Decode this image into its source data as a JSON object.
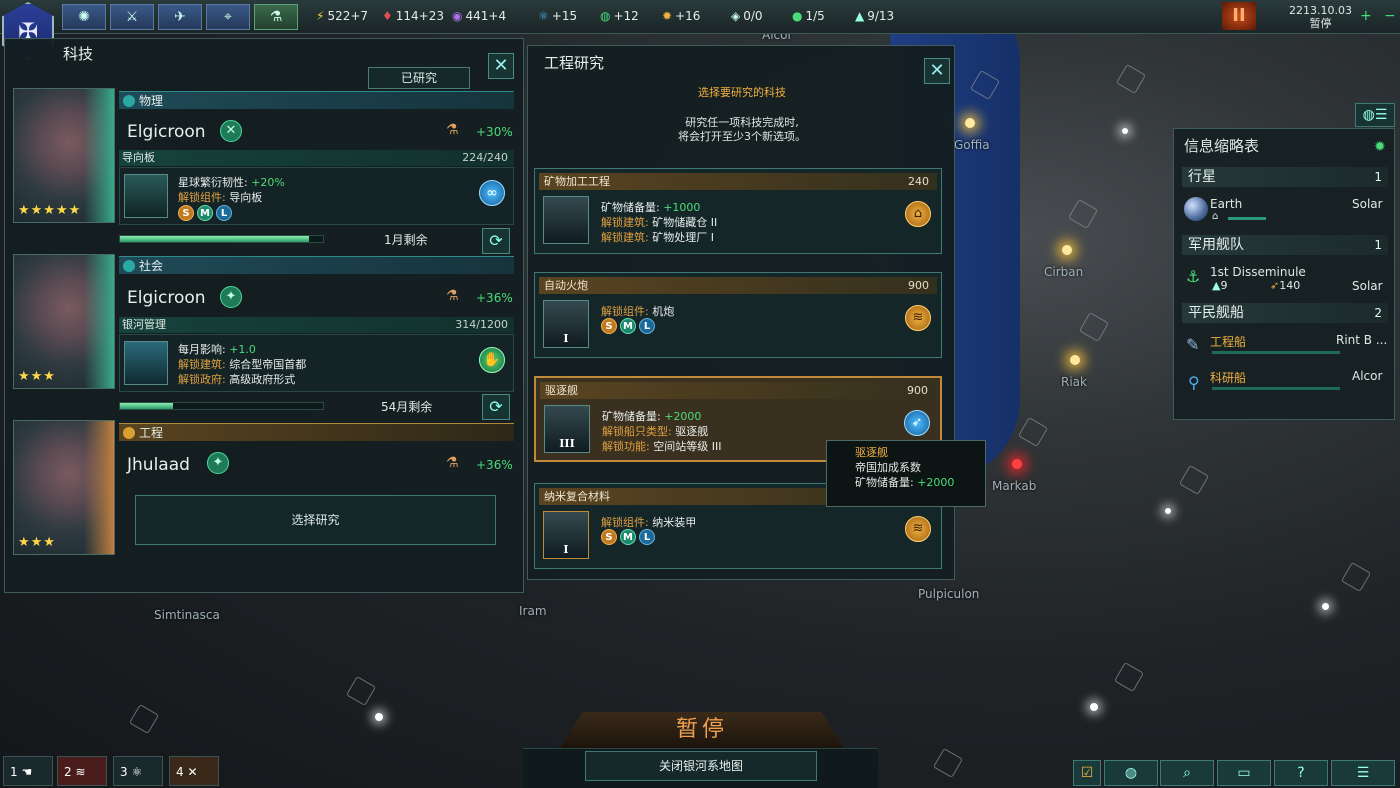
{
  "topbar": {
    "tabs": [
      {
        "icon": "galaxy-icon"
      },
      {
        "icon": "fleet-icon"
      },
      {
        "icon": "ships-icon"
      },
      {
        "icon": "map-icon"
      },
      {
        "icon": "tech-icon"
      }
    ],
    "resources": [
      {
        "icon": "energy-icon",
        "glyph": "⚡",
        "value": "522+7"
      },
      {
        "icon": "minerals-icon",
        "glyph": "♦",
        "value": "114+23"
      },
      {
        "icon": "influence-icon",
        "glyph": "◉",
        "value": "441+4"
      },
      {
        "icon": "physics-icon",
        "glyph": "⚛",
        "value": "+15"
      },
      {
        "icon": "society-icon",
        "glyph": "◍",
        "value": "+12"
      },
      {
        "icon": "engineering-icon",
        "glyph": "✹",
        "value": "+16"
      },
      {
        "icon": "edicts-icon",
        "glyph": "◈",
        "value": "0/0"
      },
      {
        "icon": "planets-icon",
        "glyph": "●",
        "value": "1/5"
      },
      {
        "icon": "fleet-cap-icon",
        "glyph": "▲",
        "value": "9/13"
      }
    ],
    "date": "2213.10.03",
    "status": "暂停"
  },
  "tech_panel": {
    "title": "科技",
    "researched_button": "已研究",
    "categories": [
      {
        "name": "物理",
        "scientist": "Elgicroon",
        "stars": "★★★★★",
        "bonus": "+30%",
        "project": "导向板",
        "progress_text": "224/240",
        "progress": 0.93,
        "effect_label": "星球繁衍韧性: ",
        "effect_value": "+20%",
        "unlock_label": "解锁组件: ",
        "unlock_value": "导向板",
        "remaining": "1月剩余"
      },
      {
        "name": "社会",
        "scientist": "Elgicroon",
        "stars": "★★★",
        "bonus": "+36%",
        "project": "银河管理",
        "progress_text": "314/1200",
        "progress": 0.26,
        "effect_label": "每月影响: ",
        "effect_value": "+1.0",
        "unlock_label": "解锁建筑: ",
        "unlock_value": "综合型帝国首都",
        "unlock2_label": "解锁政府: ",
        "unlock2_value": "高级政府形式",
        "remaining": "54月剩余"
      },
      {
        "name": "工程",
        "scientist": "Jhulaad",
        "stars": "★★★",
        "bonus": "+36%",
        "select_button": "选择研究"
      }
    ]
  },
  "eng_panel": {
    "title": "工程研究",
    "subtitle": "选择要研究的科技",
    "desc1": "研究任一项科技完成时,",
    "desc2": "将会打开至少3个新选项。",
    "options": [
      {
        "name": "矿物加工工程",
        "cost": "240",
        "l1k": "矿物储备量: ",
        "l1v": "+1000",
        "l2k": "解锁建筑: ",
        "l2v": "矿物储藏仓 II",
        "l3k": "解锁建筑: ",
        "l3v": "矿物处理厂 I",
        "badge_icon": "factory-icon"
      },
      {
        "name": "自动火炮",
        "cost": "900",
        "l1k": "解锁组件: ",
        "l1v": "机炮",
        "tier": "I",
        "badge_icon": "industry-icon"
      },
      {
        "name": "驱逐舰",
        "cost": "900",
        "l1k": "矿物储备量: ",
        "l1v": "+2000",
        "l2k": "解锁船只类型: ",
        "l2v": "驱逐舰",
        "l3k": "解锁功能: ",
        "l3v": "空间站等级 III",
        "tier": "III",
        "badge_icon": "rocket-icon"
      },
      {
        "name": "纳米复合材料",
        "cost": "",
        "l1k": "解锁组件: ",
        "l1v": "纳米装甲",
        "tier": "I",
        "badge_icon": "industry-icon"
      }
    ]
  },
  "tooltip": {
    "title": "驱逐舰",
    "line1": "帝国加成系数",
    "line2k": "矿物储备量: ",
    "line2v": "+2000"
  },
  "outliner": {
    "title": "信息缩略表",
    "planets_label": "行星",
    "planets_count": "1",
    "planet_name": "Earth",
    "planet_system": "Solar",
    "military_label": "军用舰队",
    "military_count": "1",
    "fleet_name": "1st Disseminule",
    "fleet_ships": "9",
    "fleet_power": "140",
    "fleet_location": "Solar",
    "civilian_label": "平民舰船",
    "civilian_count": "2",
    "civ1_name": "工程船",
    "civ1_loc": "Rint B ...",
    "civ2_name": "科研船",
    "civ2_loc": "Alcor"
  },
  "map": {
    "systems": [
      "Goffia",
      "Cirban",
      "Riak",
      "Markab",
      "Simtinasca",
      "Iram",
      "Pulpiculon",
      "Alcor"
    ]
  },
  "bottom": {
    "paused": "暂停",
    "close_galaxy": "关闭银河系地图",
    "shortcuts": [
      "1",
      "2",
      "3",
      "4"
    ]
  }
}
